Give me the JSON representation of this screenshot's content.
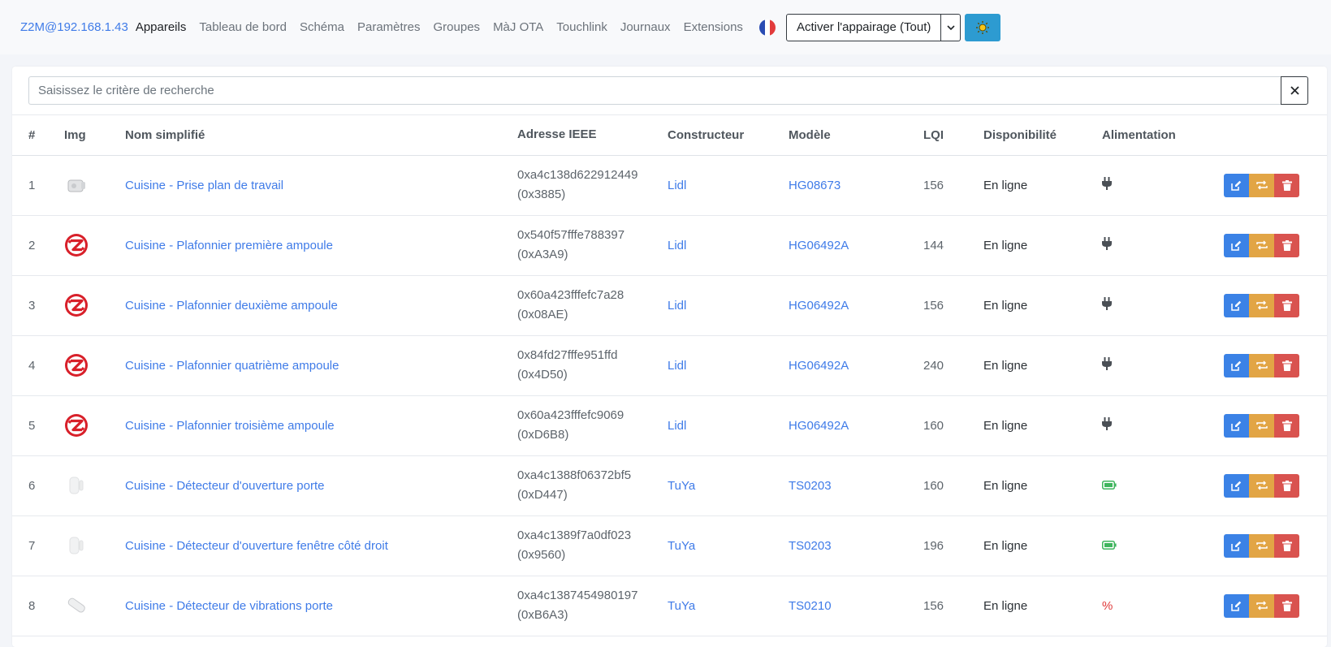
{
  "nav": {
    "brand": "Z2M@192.168.1.43",
    "links": [
      "Appareils",
      "Tableau de bord",
      "Schéma",
      "Paramètres",
      "Groupes",
      "MàJ OTA",
      "Touchlink",
      "Journaux",
      "Extensions"
    ],
    "pairing_label": "Activer l'appairage (Tout)"
  },
  "search": {
    "placeholder": "Saisissez le critère de recherche"
  },
  "table": {
    "headers": [
      "#",
      "Img",
      "Nom simplifié",
      "Adresse IEEE",
      "Constructeur",
      "Modèle",
      "LQI",
      "Disponibilité",
      "Alimentation"
    ],
    "rows": [
      {
        "num": "1",
        "img": "plug",
        "name": "Cuisine - Prise plan de travail",
        "ieee": "0xa4c138d622912449",
        "nwk": "(0x3885)",
        "manufacturer": "Lidl",
        "model": "HG08673",
        "lqi": "156",
        "availability": "En ligne",
        "power": "mains"
      },
      {
        "num": "2",
        "img": "zigbee",
        "name": "Cuisine - Plafonnier première ampoule",
        "ieee": "0x540f57fffe788397",
        "nwk": "(0xA3A9)",
        "manufacturer": "Lidl",
        "model": "HG06492A",
        "lqi": "144",
        "availability": "En ligne",
        "power": "mains"
      },
      {
        "num": "3",
        "img": "zigbee",
        "name": "Cuisine - Plafonnier deuxième ampoule",
        "ieee": "0x60a423fffefc7a28",
        "nwk": "(0x08AE)",
        "manufacturer": "Lidl",
        "model": "HG06492A",
        "lqi": "156",
        "availability": "En ligne",
        "power": "mains"
      },
      {
        "num": "4",
        "img": "zigbee",
        "name": "Cuisine - Plafonnier quatrième ampoule",
        "ieee": "0x84fd27fffe951ffd",
        "nwk": "(0x4D50)",
        "manufacturer": "Lidl",
        "model": "HG06492A",
        "lqi": "240",
        "availability": "En ligne",
        "power": "mains"
      },
      {
        "num": "5",
        "img": "zigbee",
        "name": "Cuisine - Plafonnier troisième ampoule",
        "ieee": "0x60a423fffefc9069",
        "nwk": "(0xD6B8)",
        "manufacturer": "Lidl",
        "model": "HG06492A",
        "lqi": "160",
        "availability": "En ligne",
        "power": "mains"
      },
      {
        "num": "6",
        "img": "contact",
        "name": "Cuisine - Détecteur d'ouverture porte",
        "ieee": "0xa4c1388f06372bf5",
        "nwk": "(0xD447)",
        "manufacturer": "TuYa",
        "model": "TS0203",
        "lqi": "160",
        "availability": "En ligne",
        "power": "battery"
      },
      {
        "num": "7",
        "img": "contact",
        "name": "Cuisine - Détecteur d'ouverture fenêtre côté droit",
        "ieee": "0xa4c1389f7a0df023",
        "nwk": "(0x9560)",
        "manufacturer": "TuYa",
        "model": "TS0203",
        "lqi": "196",
        "availability": "En ligne",
        "power": "battery"
      },
      {
        "num": "8",
        "img": "vibration",
        "name": "Cuisine - Détecteur de vibrations porte",
        "ieee": "0xa4c1387454980197",
        "nwk": "(0xB6A3)",
        "manufacturer": "TuYa",
        "model": "TS0210",
        "lqi": "156",
        "availability": "En ligne",
        "power": "percent",
        "power_text": "%"
      }
    ]
  },
  "colors": {
    "accent": "#3f7be8",
    "edit": "#3b82e6",
    "swap": "#e2a545",
    "delete": "#d9534f",
    "battery": "#3fb55e",
    "percent": "#e03a3a"
  }
}
